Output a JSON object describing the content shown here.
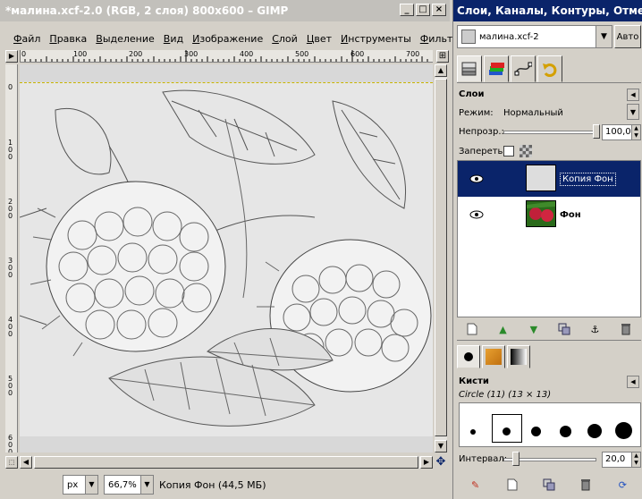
{
  "main_window": {
    "title": "*малина.xcf-2.0 (RGB, 2 слоя) 800x600 – GIMP",
    "menu": [
      "Файл",
      "Правка",
      "Выделение",
      "Вид",
      "Изображение",
      "Слой",
      "Цвет",
      "Инструменты",
      "Фильтры"
    ],
    "ruler_top": [
      "0",
      "100",
      "200",
      "300",
      "400",
      "500",
      "600",
      "700"
    ],
    "ruler_left": [
      "0",
      "100",
      "200",
      "300",
      "400",
      "500",
      "600"
    ],
    "status": {
      "unit": "px",
      "zoom": "66,7%",
      "layer_info": "Копия Фон (44,5 МБ)"
    }
  },
  "dock": {
    "title": "Слои, Каналы, Контуры, Отмени...",
    "image_select": "малина.xcf-2",
    "auto_button": "Авто",
    "tabs": [
      "layers-tab",
      "channels-tab",
      "paths-tab",
      "undo-tab"
    ],
    "layers_panel": {
      "title": "Слои",
      "mode_label": "Режим:",
      "mode_value": "Нормальный",
      "opacity_label": "Непрозр.:",
      "opacity_value": "100,0",
      "opacity": 1.0,
      "lock_label": "Запереть:",
      "layers": [
        {
          "name": "Копия Фон",
          "selected": true,
          "visible": true
        },
        {
          "name": "Фон",
          "selected": false,
          "visible": true
        }
      ]
    },
    "brushes_panel": {
      "title": "Кисти",
      "brush_name": "Circle (11) (13 × 13)",
      "interval_label": "Интервал:",
      "interval_value": "20,0",
      "interval": 20
    }
  }
}
